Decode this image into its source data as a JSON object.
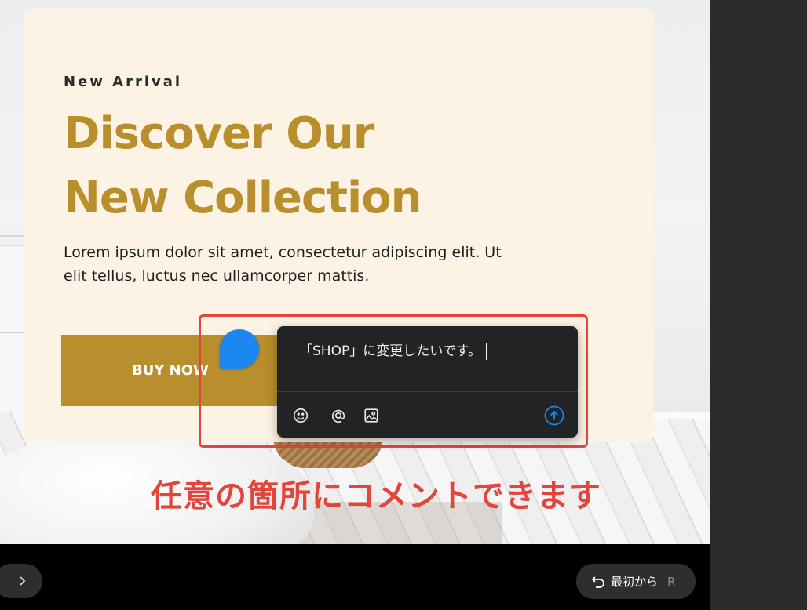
{
  "hero": {
    "eyebrow": "New Arrival",
    "headline_line1": "Discover Our",
    "headline_line2": "New Collection",
    "body_line1": "Lorem ipsum dolor sit amet, consectetur adipiscing elit. Ut",
    "body_line2": "elit tellus, luctus nec ullamcorper mattis.",
    "button_label": "BUY NOW"
  },
  "comment": {
    "text": "「SHOP」に変更したいです。",
    "tools": [
      "emoji-icon",
      "mention-icon",
      "image-icon"
    ],
    "send_icon": "send-arrow-icon"
  },
  "annotation": {
    "text": "任意の箇所にコメントできます"
  },
  "controls": {
    "next_icon": "chevron-right-icon",
    "restart_label": "最初から",
    "restart_key": "R",
    "restart_icon": "undo-icon"
  },
  "colors": {
    "accent_gold": "#b88f2c",
    "card_bg": "#fdf3e4",
    "highlight_red": "#e2453c",
    "pin_blue": "#1a87f0",
    "comment_bg": "#222325"
  }
}
